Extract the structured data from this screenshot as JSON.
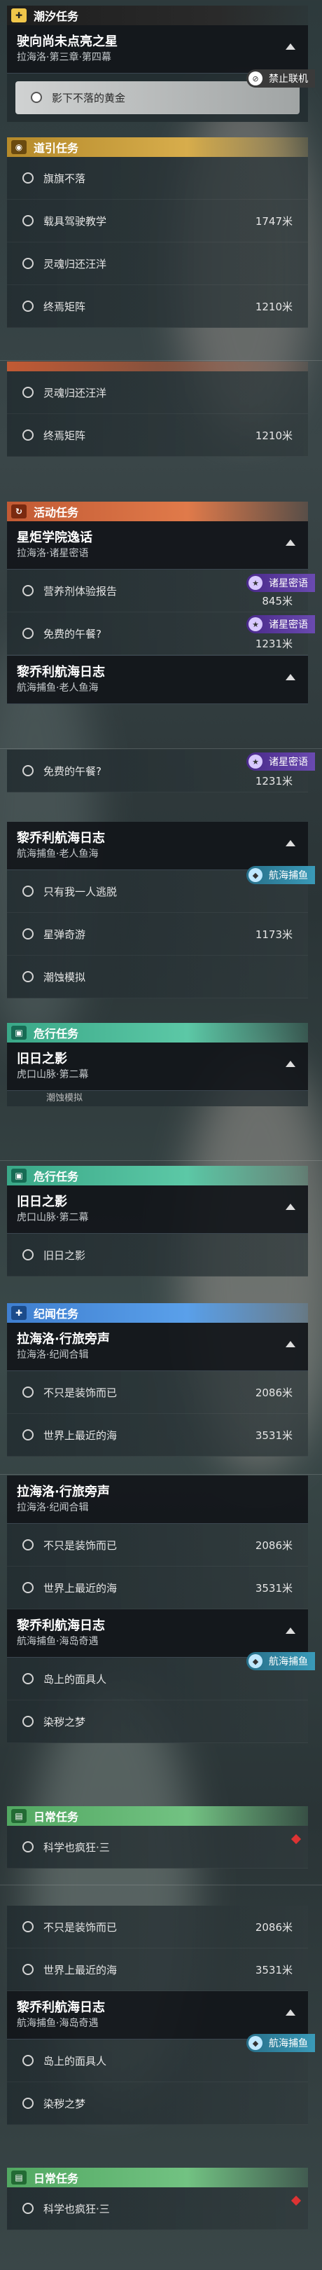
{
  "tide": {
    "category": "潮汐任务",
    "title": "驶向尚未点亮之星",
    "sub": "拉海洛·第三章·第四幕",
    "selected": "影下不落的黄金",
    "badge": "禁止联机"
  },
  "guide": {
    "category": "道引任务",
    "items": [
      {
        "label": "旗旗不落",
        "dist": ""
      },
      {
        "label": "载具驾驶教学",
        "dist": "1747米"
      },
      {
        "label": "灵魂归还汪洋",
        "dist": ""
      },
      {
        "label": "终焉矩阵",
        "dist": "1210米"
      }
    ]
  },
  "guide_repeat": {
    "items": [
      {
        "label": "灵魂归还汪洋",
        "dist": ""
      },
      {
        "label": "终焉矩阵",
        "dist": "1210米"
      }
    ]
  },
  "activity": {
    "category": "活动任务",
    "card1": {
      "title": "星炬学院逸话",
      "sub": "拉海洛·诸星密语",
      "badge": "诸星密语",
      "items": [
        {
          "label": "营养剂体验报告",
          "dist": "845米"
        },
        {
          "label": "免费的午餐?",
          "dist": "1231米"
        }
      ]
    },
    "card2": {
      "title": "黎乔利航海日志",
      "sub": "航海捕鱼·老人鱼海",
      "badge": "诸星密语",
      "item": {
        "label": "免费的午餐?",
        "dist": "1231米"
      }
    },
    "card3": {
      "title": "黎乔利航海日志",
      "sub": "航海捕鱼·老人鱼海",
      "badge": "航海捕鱼",
      "items": [
        {
          "label": "只有我一人逃脱",
          "dist": ""
        },
        {
          "label": "星弹奇游",
          "dist": "1173米"
        },
        {
          "label": "潮蚀模拟",
          "dist": ""
        }
      ]
    }
  },
  "danger": {
    "category": "危行任务",
    "title": "旧日之影",
    "sub": "虎口山脉·第二幕",
    "peek": "潮蚀模拟",
    "item": "旧日之影"
  },
  "chronicle": {
    "category": "纪闻任务",
    "card1": {
      "title": "拉海洛·行旅旁声",
      "sub": "拉海洛·纪闻合辑",
      "items": [
        {
          "label": "不只是装饰而已",
          "dist": "2086米"
        },
        {
          "label": "世界上最近的海",
          "dist": "3531米"
        }
      ]
    },
    "card2": {
      "title": "黎乔利航海日志",
      "sub": "航海捕鱼·海岛奇遇",
      "badge": "航海捕鱼",
      "items": [
        {
          "label": "岛上的面具人",
          "dist": ""
        },
        {
          "label": "染秽之梦",
          "dist": ""
        }
      ]
    }
  },
  "daily": {
    "category": "日常任务",
    "item": "科学也疯狂·三"
  }
}
